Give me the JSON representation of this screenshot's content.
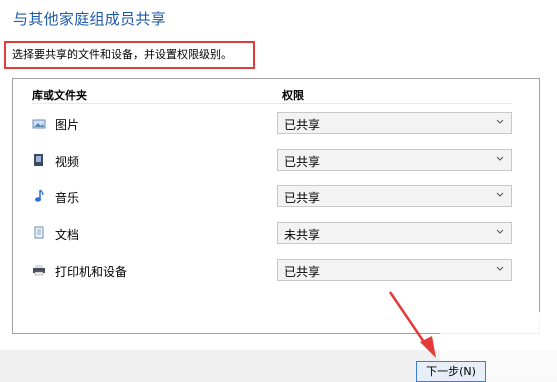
{
  "dialog": {
    "title": "与其他家庭组成员共享",
    "instruction": "选择要共享的文件和设备，并设置权限级别。"
  },
  "table": {
    "headers": {
      "library": "库或文件夹",
      "permission": "权限"
    },
    "rows": [
      {
        "label": "图片",
        "icon": "pictures-icon",
        "permission": "已共享"
      },
      {
        "label": "视频",
        "icon": "videos-icon",
        "permission": "已共享"
      },
      {
        "label": "音乐",
        "icon": "music-icon",
        "permission": "已共享"
      },
      {
        "label": "文档",
        "icon": "documents-icon",
        "permission": "未共享"
      },
      {
        "label": "打印机和设备",
        "icon": "printer-icon",
        "permission": "已共享"
      }
    ]
  },
  "footer": {
    "next_label": "下一步(N)"
  },
  "colors": {
    "title": "#1e5aa8",
    "highlight": "#e33a3a",
    "button_border": "#3c7fd6"
  }
}
